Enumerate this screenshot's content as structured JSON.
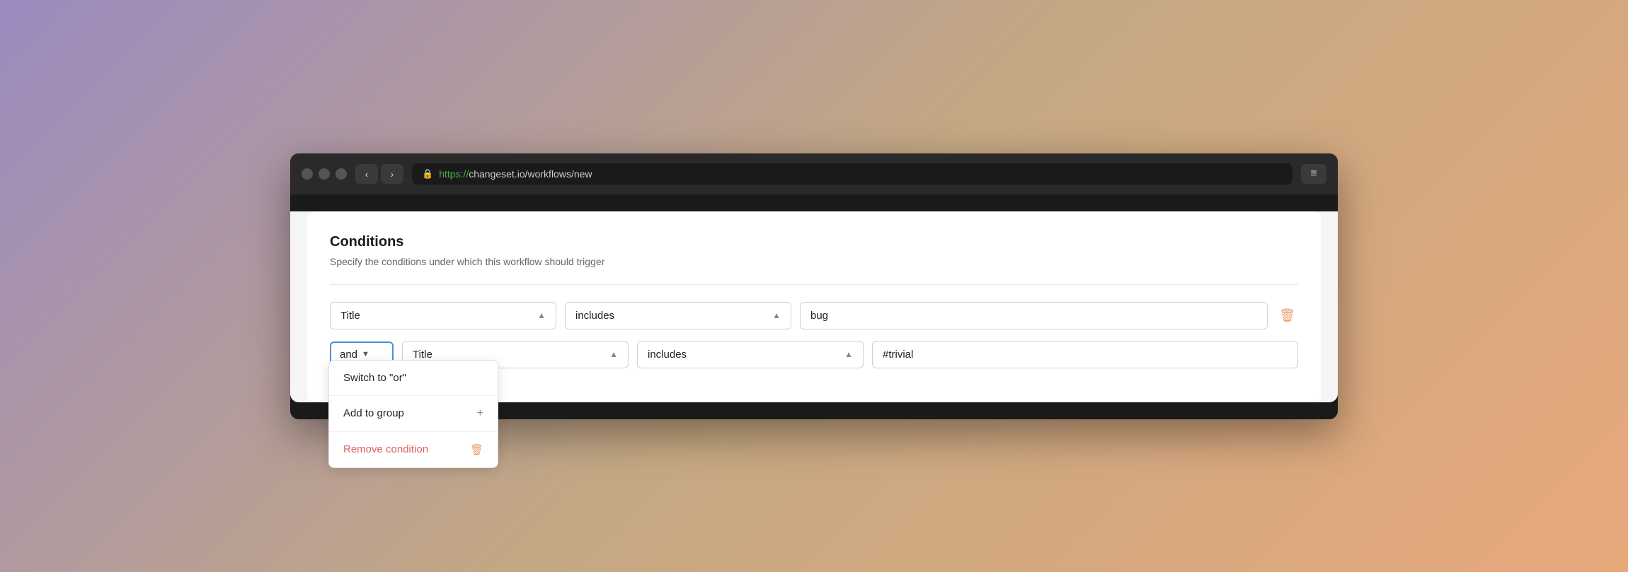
{
  "browser": {
    "url_https": "https://",
    "url_domain": "changeset.io/workflows/new",
    "back_label": "‹",
    "forward_label": "›",
    "menu_icon": "≡"
  },
  "page": {
    "title": "Conditions",
    "subtitle": "Specify the conditions under which this workflow should trigger"
  },
  "condition_row1": {
    "field_label": "Title",
    "operator_label": "includes",
    "value": "bug"
  },
  "condition_row2": {
    "and_label": "and",
    "field_label": "Title",
    "operator_label": "includes",
    "value": "#trivial"
  },
  "dropdown_menu": {
    "switch_label": "Switch to \"or\"",
    "add_group_label": "Add to group",
    "remove_label": "Remove condition",
    "plus_icon": "+",
    "trash_icon": "🗑"
  }
}
